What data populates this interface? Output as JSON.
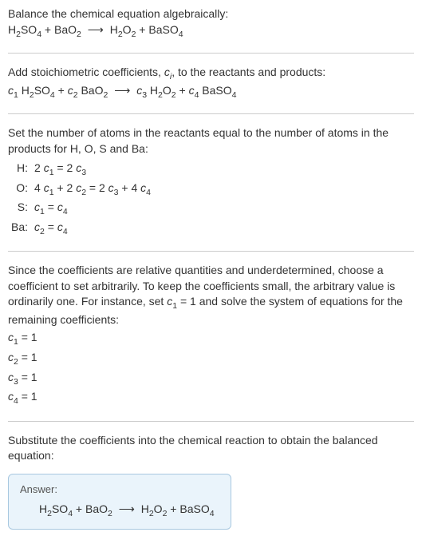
{
  "step1": {
    "intro": "Balance the chemical equation algebraically:",
    "equation_html": "H<sub>2</sub>SO<sub>4</sub> + BaO<sub>2</sub> <span class='arrow'>⟶</span> H<sub>2</sub>O<sub>2</sub> + BaSO<sub>4</sub>"
  },
  "step2": {
    "intro_html": "Add stoichiometric coefficients, <span class='italic'>c<sub>i</sub></span>, to the reactants and products:",
    "equation_html": "<span class='italic'>c</span><sub>1</sub> H<sub>2</sub>SO<sub>4</sub> + <span class='italic'>c</span><sub>2</sub> BaO<sub>2</sub> <span class='arrow'>⟶</span> <span class='italic'>c</span><sub>3</sub> H<sub>2</sub>O<sub>2</sub> + <span class='italic'>c</span><sub>4</sub> BaSO<sub>4</sub>"
  },
  "step3": {
    "intro": "Set the number of atoms in the reactants equal to the number of atoms in the products for H, O, S and Ba:",
    "rows": [
      {
        "label": "H:",
        "eq_html": "2 <span class='italic'>c</span><sub>1</sub> = 2 <span class='italic'>c</span><sub>3</sub>"
      },
      {
        "label": "O:",
        "eq_html": "4 <span class='italic'>c</span><sub>1</sub> + 2 <span class='italic'>c</span><sub>2</sub> = 2 <span class='italic'>c</span><sub>3</sub> + 4 <span class='italic'>c</span><sub>4</sub>"
      },
      {
        "label": "S:",
        "eq_html": "<span class='italic'>c</span><sub>1</sub> = <span class='italic'>c</span><sub>4</sub>"
      },
      {
        "label": "Ba:",
        "eq_html": "<span class='italic'>c</span><sub>2</sub> = <span class='italic'>c</span><sub>4</sub>"
      }
    ]
  },
  "step4": {
    "intro_html": "Since the coefficients are relative quantities and underdetermined, choose a coefficient to set arbitrarily. To keep the coefficients small, the arbitrary value is ordinarily one. For instance, set <span class='italic'>c</span><sub>1</sub> = 1 and solve the system of equations for the remaining coefficients:",
    "coeffs": [
      "<span class='italic'>c</span><sub>1</sub> = 1",
      "<span class='italic'>c</span><sub>2</sub> = 1",
      "<span class='italic'>c</span><sub>3</sub> = 1",
      "<span class='italic'>c</span><sub>4</sub> = 1"
    ]
  },
  "step5": {
    "intro": "Substitute the coefficients into the chemical reaction to obtain the balanced equation:"
  },
  "answer": {
    "label": "Answer:",
    "equation_html": "H<sub>2</sub>SO<sub>4</sub> + BaO<sub>2</sub> <span class='arrow'>⟶</span> H<sub>2</sub>O<sub>2</sub> + BaSO<sub>4</sub>"
  }
}
